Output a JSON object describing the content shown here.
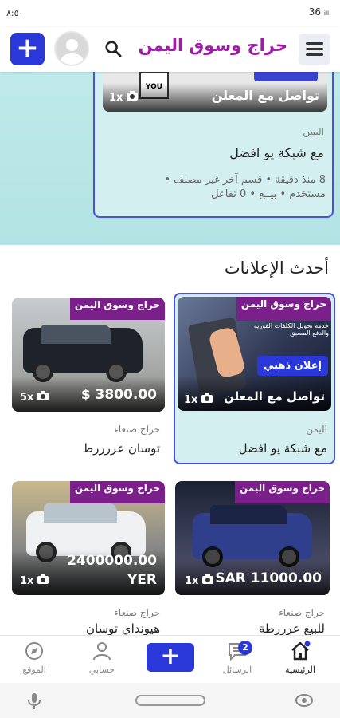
{
  "status": {
    "time": "٨:٥٠",
    "right": "36 ᵢₗₗ"
  },
  "header": {
    "brand": "حراج وسوق اليمن",
    "add_label": "+"
  },
  "hero": {
    "contact": "تواصل مع المعلن",
    "photo_count": "1x",
    "region": "اليمن",
    "title": "مع شبكة يو افضل",
    "meta_line1": "8 منذ دقيقة • قسم آخر غير مصنف •",
    "meta_line2": "مستخدم • بيــع • 0 تفاعل"
  },
  "latest": {
    "title": "أحدث الإعلانات",
    "items": [
      {
        "contact": "تواصل مع المعلن",
        "photo_count": "1x",
        "badge": "إعلان ذهبي",
        "region": "اليمن",
        "title": "مع شبكة يو افضل",
        "watermark": "حراج وسوق اليمن",
        "image_text": "خدمة تحويل الكلفات الفورية والدفع المسبق"
      },
      {
        "price": "$ 3800.00",
        "photo_count": "5x",
        "region": "حراج صنعاء",
        "title": "توسان عررررط",
        "watermark": "حراج وسوق اليمن"
      },
      {
        "price": "SAR 11000.00",
        "photo_count": "1x",
        "region": "حراج صنعاء",
        "title": "للبيع عرررطة",
        "watermark": "حراج وسوق اليمن"
      },
      {
        "price": "2400000.00",
        "currency": "YER",
        "photo_count": "1x",
        "region": "حراج صنعاء",
        "title": "هيونداي توسان",
        "watermark": "حراج وسوق اليمن"
      }
    ]
  },
  "nav": {
    "home": "الرئيسية",
    "messages": "الرسائل",
    "messages_badge": "2",
    "account": "حسابي",
    "location": "الموقع"
  },
  "colors": {
    "accent": "#2b38d9",
    "brand": "#a01ba8",
    "hero_bg": "#bfe9ea"
  }
}
